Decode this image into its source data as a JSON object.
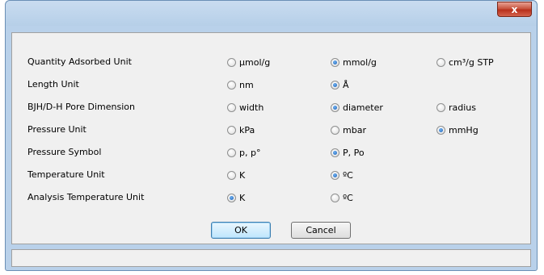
{
  "window": {
    "close_label": "x"
  },
  "form": {
    "rows": [
      {
        "label": "Quantity Adsorbed Unit",
        "options": [
          {
            "label": "μmol/g",
            "selected": false
          },
          {
            "label": "mmol/g",
            "selected": true
          },
          {
            "label": "cm³/g STP",
            "selected": false
          }
        ]
      },
      {
        "label": "Length Unit",
        "options": [
          {
            "label": "nm",
            "selected": false
          },
          {
            "label": "Å",
            "selected": true
          }
        ]
      },
      {
        "label": "BJH/D-H Pore Dimension",
        "options": [
          {
            "label": "width",
            "selected": false
          },
          {
            "label": "diameter",
            "selected": true
          },
          {
            "label": "radius",
            "selected": false
          }
        ]
      },
      {
        "label": "Pressure Unit",
        "options": [
          {
            "label": "kPa",
            "selected": false
          },
          {
            "label": "mbar",
            "selected": false
          },
          {
            "label": "mmHg",
            "selected": true
          }
        ]
      },
      {
        "label": "Pressure Symbol",
        "options": [
          {
            "label": "p, p°",
            "selected": false
          },
          {
            "label": "P, Po",
            "selected": true
          }
        ]
      },
      {
        "label": "Temperature Unit",
        "options": [
          {
            "label": "K",
            "selected": false
          },
          {
            "label": "ºC",
            "selected": true
          }
        ]
      },
      {
        "label": "Analysis Temperature Unit",
        "options": [
          {
            "label": "K",
            "selected": true
          },
          {
            "label": "ºC",
            "selected": false
          }
        ]
      }
    ]
  },
  "buttons": {
    "ok": "OK",
    "cancel": "Cancel"
  },
  "colors": {
    "frame": "#b9d1ea",
    "client": "#f0f0f0",
    "close": "#c8553f",
    "radio_selected": "#1c5fb4"
  }
}
